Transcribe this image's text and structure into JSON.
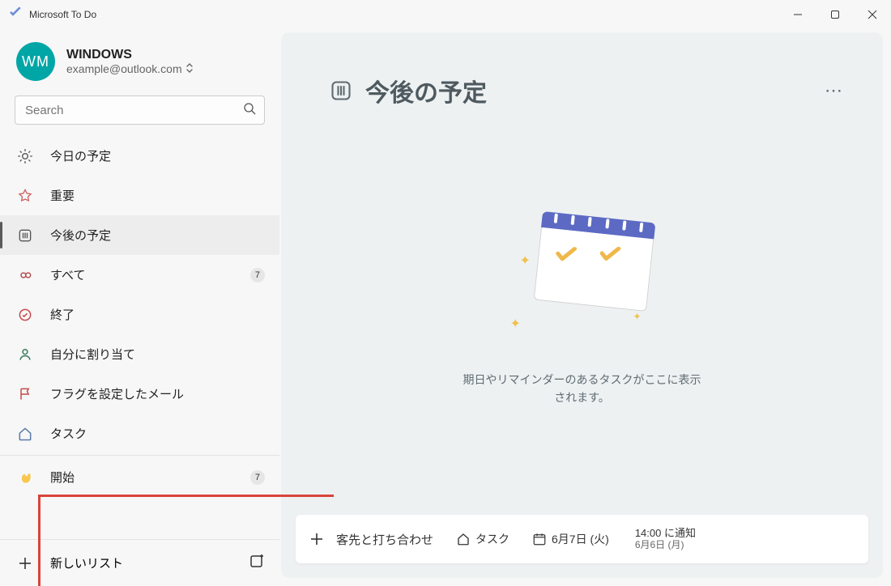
{
  "titlebar": {
    "app_name": "Microsoft To Do"
  },
  "profile": {
    "initials": "WM",
    "name": "WINDOWS",
    "email": "example@outlook.com"
  },
  "search": {
    "placeholder": "Search"
  },
  "nav": {
    "my_day": "今日の予定",
    "important": "重要",
    "planned": "今後の予定",
    "all": "すべて",
    "all_count": "7",
    "completed": "終了",
    "assigned": "自分に割り当て",
    "flagged": "フラグを設定したメール",
    "tasks": "タスク",
    "getting_started": "開始",
    "getting_started_count": "7"
  },
  "new_list": {
    "label": "新しいリスト"
  },
  "panel": {
    "title": "今後の予定"
  },
  "empty_state": {
    "line1": "期日やリマインダーのあるタスクがここに表示",
    "line2": "されます。"
  },
  "addbar": {
    "task_title": "客先と打ち合わせ",
    "list_chip": "タスク",
    "due_chip": "6月7日 (火)",
    "reminder_line1": "14:00 に通知",
    "reminder_line2": "6月6日 (月)"
  }
}
